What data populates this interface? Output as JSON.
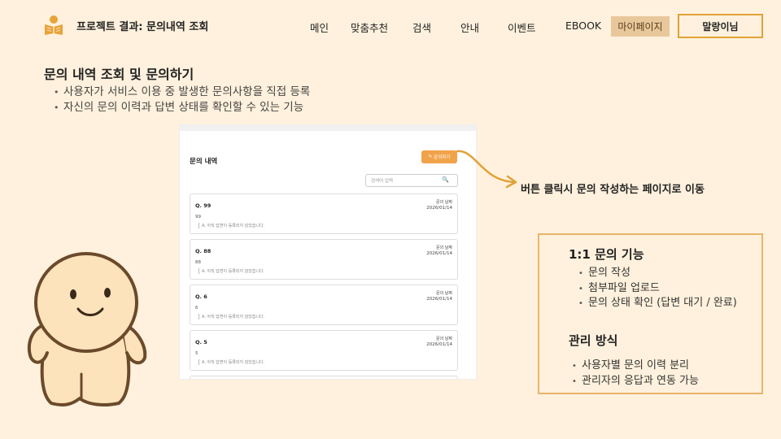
{
  "header": {
    "project_title": "프로젝트 결과: 문의내역 조회",
    "nav": [
      "메인",
      "맞춤추천",
      "검색",
      "안내",
      "이벤트",
      "EBOOK"
    ],
    "mypage": "마이페이지",
    "user": "말랑이님"
  },
  "section": {
    "title": "문의 내역 조회 및 문의하기",
    "bullets": [
      "사용자가 서비스 이용 중 발생한 문의사항을 직접 등록",
      "자신의 문의 이력과 답변 상태를 확인할 수 있는 기능"
    ]
  },
  "screenshot": {
    "title": "문의 내역",
    "write_button": "문의하기",
    "search_placeholder": "검색어 입력",
    "cards": [
      {
        "num": "Q. 99",
        "content": "99",
        "answer": "A. 아직 답변이 등록되지 않았습니다.",
        "date_label": "문의 날짜",
        "date": "2026/01/14"
      },
      {
        "num": "Q. 88",
        "content": "88",
        "answer": "A. 아직 답변이 등록되지 않았습니다.",
        "date_label": "문의 날짜",
        "date": "2026/01/14"
      },
      {
        "num": "Q. 6",
        "content": "6",
        "answer": "A. 아직 답변이 등록되지 않았습니다.",
        "date_label": "문의 날짜",
        "date": "2026/01/14"
      },
      {
        "num": "Q. 5",
        "content": "5",
        "answer": "A. 아직 답변이 등록되지 않았습니다.",
        "date_label": "문의 날짜",
        "date": "2026/01/14"
      }
    ]
  },
  "caption": "버튼 클릭시 문의 작성하는 페이지로 이동",
  "info": {
    "heading1": "1:1 문의 기능",
    "list1": [
      "문의 작성",
      "첨부파일 업로드",
      "문의 상태 확인 (답변 대기 / 완료)"
    ],
    "heading2": "관리 방식",
    "list2": [
      "사용자별 문의 이력 분리",
      "관리자의 응답과 연동 가능"
    ]
  },
  "colors": {
    "background": "#fff1dd",
    "accent": "#e0a238",
    "mypage_bg": "#e8c89b",
    "button_orange": "#f1a34a"
  }
}
